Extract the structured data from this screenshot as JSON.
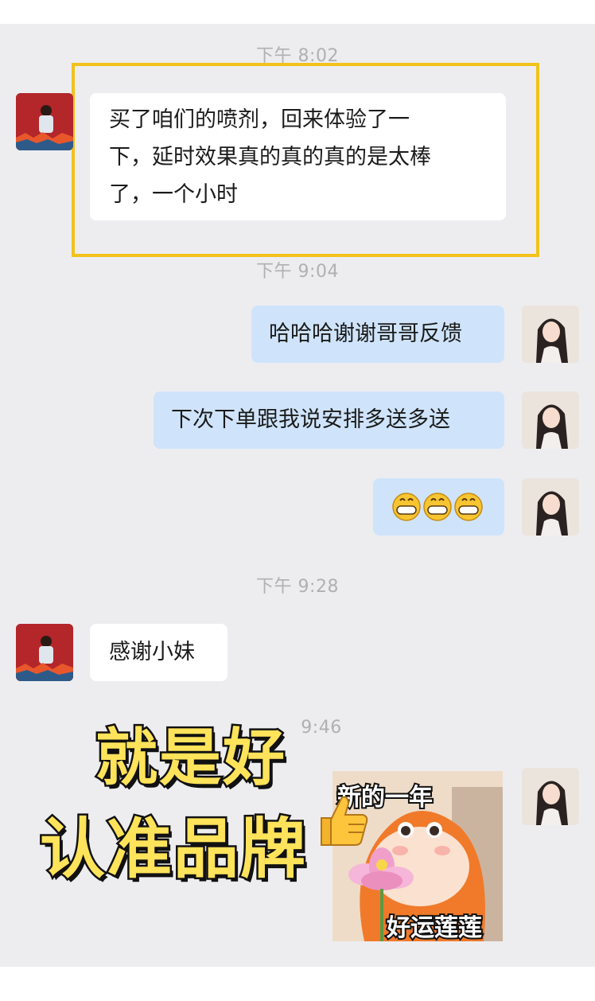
{
  "timestamps": {
    "t1": "下午 8:02",
    "t2": "下午 9:04",
    "t3": "下午 9:28",
    "t4": "9:46"
  },
  "messages": {
    "m1_line1": "买了咱们的喷剂，回来体验了一",
    "m1_line2": "下，延时效果真的真的真的是太棒",
    "m1_line3": "了，一个小时",
    "m2": "哈哈哈谢谢哥哥反馈",
    "m3": "下次下单跟我说安排多送多送",
    "m5": "感谢小妹"
  },
  "overlay": {
    "line1": "就是好",
    "line2": "认准品牌"
  },
  "sticker": {
    "top_text": "新的一年",
    "bottom_text": "好运莲莲"
  },
  "colors": {
    "chat_bg": "#ededf0",
    "bubble_in": "#ffffff",
    "bubble_out": "#cfe4fb",
    "highlight": "#f2c21a",
    "overlay_fill": "#ffe35a"
  },
  "icons": {
    "grin_emoji": "grinning-face-icon",
    "thumbs_up": "thumbs-up-icon"
  }
}
